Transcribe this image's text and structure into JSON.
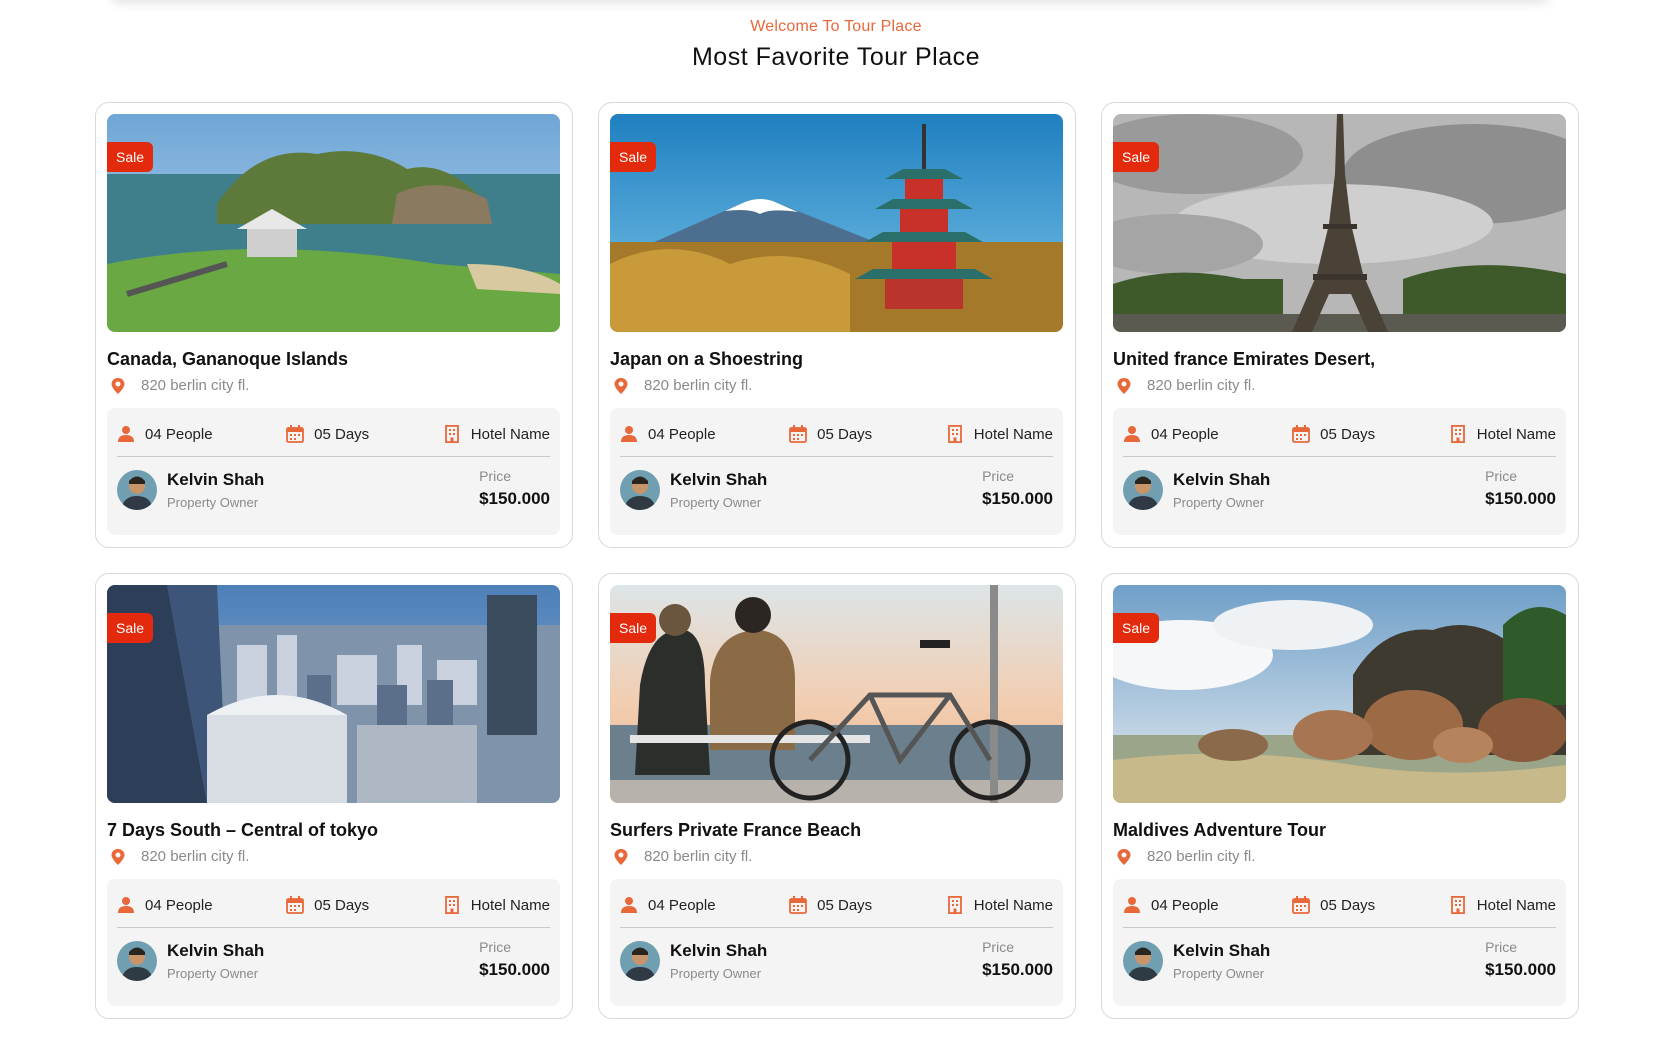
{
  "header": {
    "eyebrow": "Welcome To Tour Place",
    "title": "Most Favorite Tour Place"
  },
  "colors": {
    "accent": "#e8683a",
    "sale_badge": "#e32a0d",
    "panel_bg": "#f4f4f4"
  },
  "cards": [
    {
      "badge": "Sale",
      "title": "Canada, Gananoque Islands",
      "location": "820 berlin city fl.",
      "people": "04 People",
      "days": "05 Days",
      "hotel": "Hotel Name",
      "owner_name": "Kelvin Shah",
      "owner_role": "Property Owner",
      "price_label": "Price",
      "price": "$150.000"
    },
    {
      "badge": "Sale",
      "title": "Japan on a Shoestring",
      "location": "820 berlin city fl.",
      "people": "04 People",
      "days": "05 Days",
      "hotel": "Hotel Name",
      "owner_name": "Kelvin Shah",
      "owner_role": "Property Owner",
      "price_label": "Price",
      "price": "$150.000"
    },
    {
      "badge": "Sale",
      "title": "United france Emirates Desert,",
      "location": "820 berlin city fl.",
      "people": "04 People",
      "days": "05 Days",
      "hotel": "Hotel Name",
      "owner_name": "Kelvin Shah",
      "owner_role": "Property Owner",
      "price_label": "Price",
      "price": "$150.000"
    },
    {
      "badge": "Sale",
      "title": "7 Days South – Central of tokyo",
      "location": "820 berlin city fl.",
      "people": "04 People",
      "days": "05 Days",
      "hotel": "Hotel Name",
      "owner_name": "Kelvin Shah",
      "owner_role": "Property Owner",
      "price_label": "Price",
      "price": "$150.000"
    },
    {
      "badge": "Sale",
      "title": "Surfers Private France Beach",
      "location": "820 berlin city fl.",
      "people": "04 People",
      "days": "05 Days",
      "hotel": "Hotel Name",
      "owner_name": "Kelvin Shah",
      "owner_role": "Property Owner",
      "price_label": "Price",
      "price": "$150.000"
    },
    {
      "badge": "Sale",
      "title": "Maldives Adventure Tour",
      "location": "820 berlin city fl.",
      "people": "04 People",
      "days": "05 Days",
      "hotel": "Hotel Name",
      "owner_name": "Kelvin Shah",
      "owner_role": "Property Owner",
      "price_label": "Price",
      "price": "$150.000"
    }
  ]
}
